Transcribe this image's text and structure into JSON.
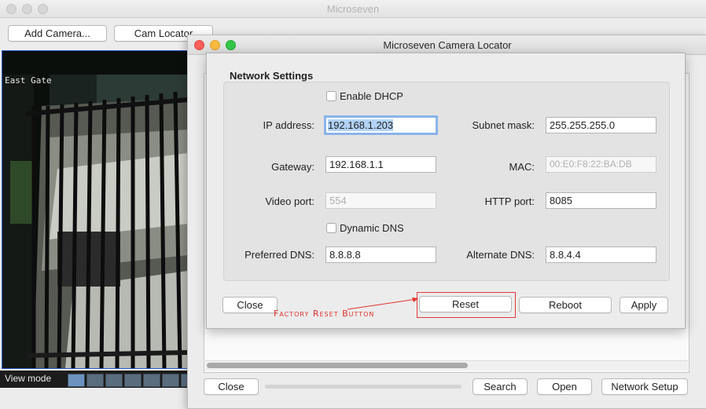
{
  "main_window": {
    "title": "Microseven",
    "toolbar": {
      "add_camera_label": "Add Camera...",
      "cam_locator_label": "Cam Locator"
    },
    "camera_feed": {
      "overlay_label": "East Gate"
    },
    "view_mode": {
      "label": "View mode"
    }
  },
  "locator_window": {
    "title": "Microseven Camera Locator",
    "buttons": {
      "close": "Close",
      "search": "Search",
      "open": "Open",
      "network_setup": "Network Setup"
    }
  },
  "network_dialog": {
    "group_title": "Network Settings",
    "enable_dhcp": {
      "label": "Enable DHCP",
      "checked": false
    },
    "ip_address": {
      "label": "IP address:",
      "value": "192.168.1.203"
    },
    "subnet_mask": {
      "label": "Subnet mask:",
      "value": "255.255.255.0"
    },
    "gateway": {
      "label": "Gateway:",
      "value": "192.168.1.1"
    },
    "mac": {
      "label": "MAC:",
      "value": "00:E0:F8:22:BA:DB"
    },
    "video_port": {
      "label": "Video port:",
      "value": "554"
    },
    "http_port": {
      "label": "HTTP port:",
      "value": "8085"
    },
    "dynamic_dns": {
      "label": "Dynamic DNS",
      "checked": false
    },
    "preferred_dns": {
      "label": "Preferred DNS:",
      "value": "8.8.8.8"
    },
    "alternate_dns": {
      "label": "Alternate DNS:",
      "value": "8.8.4.4"
    },
    "buttons": {
      "close": "Close",
      "reset": "Reset",
      "reboot": "Reboot",
      "apply": "Apply"
    }
  },
  "annotation": {
    "text": "Factory Reset Button",
    "color": "#e1322b"
  },
  "colors": {
    "selection_highlight": "#b3d3f7",
    "focus_ring": "#8ab4ea",
    "camera_border": "#2a5fd0"
  },
  "icons": {
    "window_controls": [
      "close-icon",
      "minimize-icon",
      "zoom-icon"
    ],
    "layout_icons": [
      "single-view-icon",
      "quad-view-icon",
      "six-view-icon",
      "eight-view-icon",
      "nine-view-icon",
      "thirteen-view-icon",
      "sixteen-view-icon"
    ]
  }
}
